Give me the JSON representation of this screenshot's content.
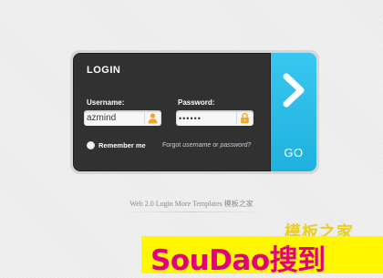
{
  "login": {
    "title": "LOGIN",
    "username_label": "Username:",
    "username_value": "azmind",
    "password_label": "Password:",
    "password_value": "••••••",
    "remember_label": "Remember me",
    "forgot_prefix": "Forgot ",
    "forgot_username": "username",
    "forgot_or": " or ",
    "forgot_password": "password?",
    "go_label": "GO"
  },
  "credit": "Web 2.0 Login More Templates 模板之家",
  "watermark": {
    "small_text": "模板之家",
    "banner_text": "SouDao搜到"
  },
  "icons": {
    "user": "user-icon",
    "lock": "lock-icon",
    "arrow": "chevron-right-icon"
  },
  "colors": {
    "panel": "#2f2f2f",
    "accent": "#2bbde9",
    "icon_orange": "#f5a623",
    "banner_bg": "#fff700",
    "banner_text": "#e3007f"
  }
}
